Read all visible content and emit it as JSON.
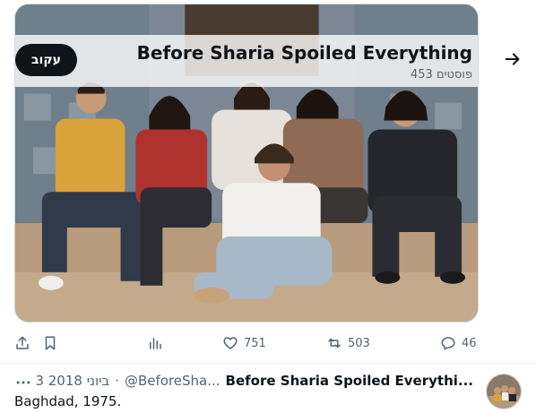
{
  "card": {
    "follow_label": "עקוב",
    "title": "Before Sharia Spoiled Everything",
    "post_count": "453 פוסטים",
    "photo_icon": "group-photo"
  },
  "actions": {
    "share_icon": "share-icon",
    "bookmark_icon": "bookmark-icon",
    "views_icon": "analytics-icon",
    "likes": "751",
    "retweets": "503",
    "replies": "46"
  },
  "tweet": {
    "author": "Before Sharia Spoiled Everythi...",
    "handle": "@BeforeSha...",
    "separator": "·",
    "date": "3 ביוני 2018",
    "text": "Baghdad, 1975."
  },
  "colors": {
    "text_primary": "#0f1419",
    "text_secondary": "#536471",
    "border": "#cfd9de"
  }
}
